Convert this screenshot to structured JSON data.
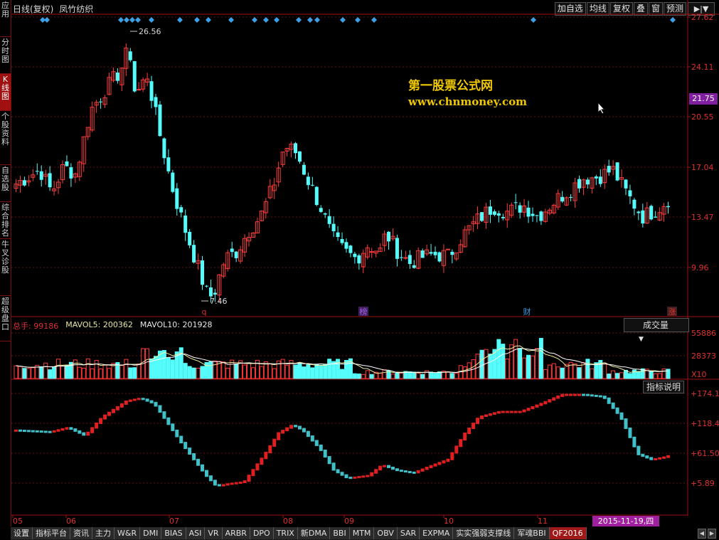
{
  "left_nav": [
    "应用",
    "分时图",
    "K线图",
    "个股资料",
    "自选股",
    "综合排名",
    "牛叉诊股",
    "超级盘口"
  ],
  "left_nav_active": 2,
  "header": {
    "chart_mode": "日线(复权)",
    "stock_name": "凤竹纺织"
  },
  "top_buttons": [
    "加自选",
    "均线",
    "复权",
    "叠",
    "窗",
    "预测"
  ],
  "top_arrow": "▶|▼",
  "watermark": {
    "line1": "第一股票公式网",
    "line2": "www.chnmoney.com"
  },
  "price_panel": {
    "axis_ticks": [
      "27.62",
      "24.11",
      "20.55",
      "17.04",
      "13.47",
      "9.96"
    ],
    "current_price": "21.75",
    "high_label": "26.56",
    "low_label": "7.46",
    "event_markers": [
      "q",
      "榜",
      "财",
      "涨"
    ]
  },
  "volume_panel": {
    "total_label": "总手: 99186",
    "ma5_label": "MAVOL5: 200362",
    "ma10_label": "MAVOL10: 201928",
    "selector": "成交量",
    "axis_ticks": [
      "55886",
      "28373",
      "X10"
    ]
  },
  "indicator_panel": {
    "button": "指标说明",
    "axis_ticks": [
      "+174.1",
      "+118.4",
      "+61.50",
      "+5.89"
    ]
  },
  "x_axis": {
    "months": [
      "05",
      "06",
      "07",
      "08",
      "09",
      "10",
      "11"
    ],
    "cursor_date": "2015-11-19,四"
  },
  "tabs": [
    "设置",
    "指标平台",
    "资讯",
    "主力",
    "W&R",
    "DMI",
    "BIAS",
    "ASI",
    "VR",
    "ARBR",
    "DPO",
    "TRIX",
    "新DMA",
    "BBI",
    "MTM",
    "OBV",
    "SAR",
    "EXPMA",
    "实实强弱支撑线",
    "军魂BBI",
    "QF2016"
  ],
  "tabs_active": 20,
  "colors": {
    "up": "#ff3c3c",
    "down": "#54fcfc",
    "grid": "#6a1010",
    "axis": "#a01010"
  },
  "chart_data": {
    "type": "candlestick",
    "price_range": [
      7.46,
      27.62
    ],
    "high": 26.56,
    "low": 7.46,
    "last_close": 21.75,
    "volume_max": 55886,
    "indicator_range": [
      5.89,
      174.1
    ]
  }
}
